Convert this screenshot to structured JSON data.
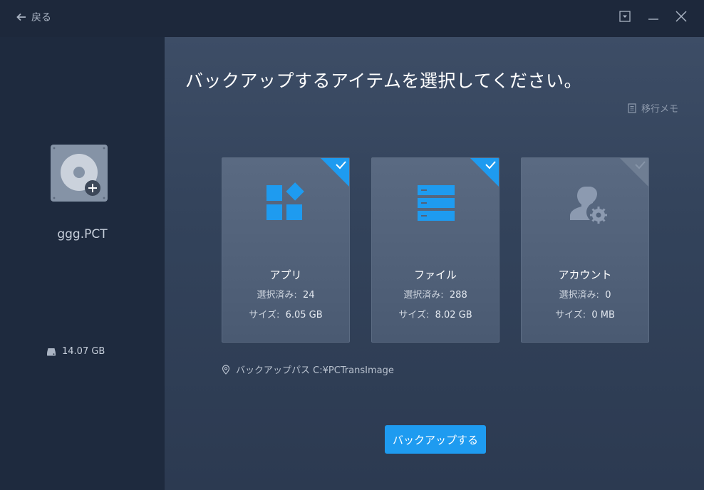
{
  "titlebar": {
    "back_label": "戻る",
    "buttons": [
      "dropdown-icon",
      "minimize-icon",
      "close-icon"
    ]
  },
  "sidebar": {
    "device_name": "ggg.PCT",
    "device_size": "14.07 GB"
  },
  "main": {
    "title": "バックアップするアイテムを選択してください。",
    "memo_label": "移行メモ",
    "cards": [
      {
        "name": "アプリ",
        "selected_label": "選択済み:",
        "selected_value": "24",
        "size_label": "サイズ:",
        "size_value": "6.05 GB",
        "checked": true,
        "icon": "apps-icon"
      },
      {
        "name": "ファイル",
        "selected_label": "選択済み:",
        "selected_value": "288",
        "size_label": "サイズ:",
        "size_value": "8.02 GB",
        "checked": true,
        "icon": "files-icon"
      },
      {
        "name": "アカウント",
        "selected_label": "選択済み:",
        "selected_value": "0",
        "size_label": "サイズ:",
        "size_value": "0 MB",
        "checked": false,
        "icon": "account-icon"
      }
    ],
    "backup_path": "バックアップパス C:¥PCTransImage",
    "backup_button": "バックアップする"
  },
  "colors": {
    "accent": "#1e9bf0",
    "card_bg": "#52627a",
    "background": "#1e2a3e"
  }
}
